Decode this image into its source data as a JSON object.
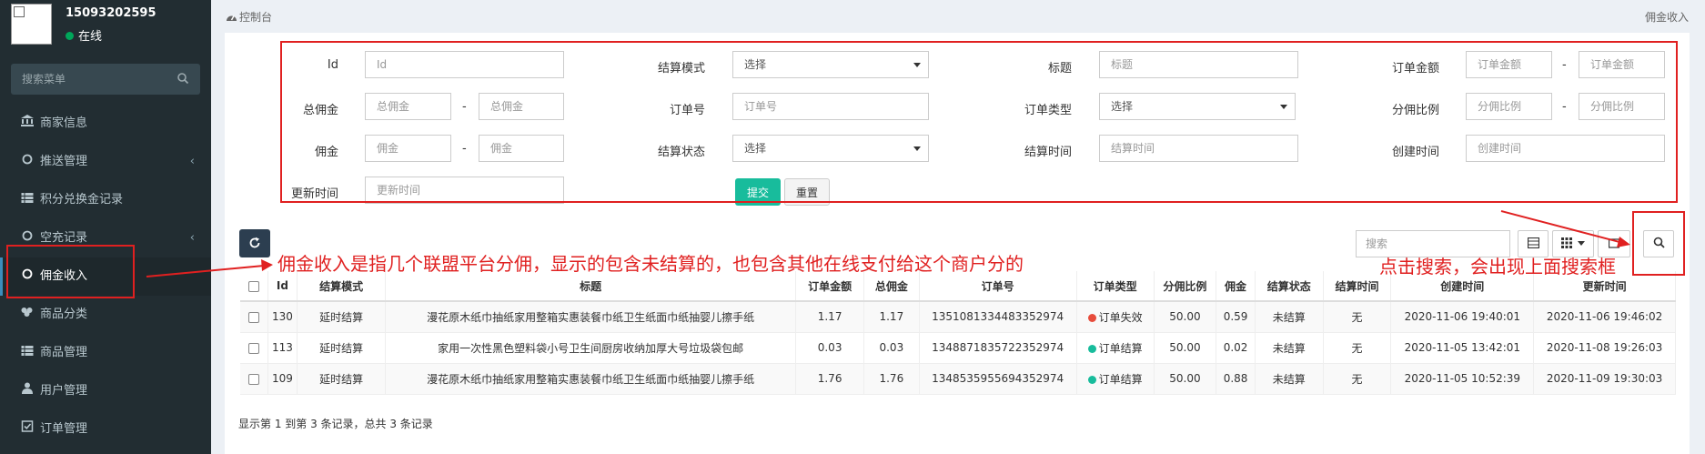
{
  "user": {
    "name": "15093202595",
    "status": "在线"
  },
  "sidebar": {
    "search_placeholder": "搜索菜单",
    "items": [
      {
        "label": "商家信息",
        "icon": "bank-icon"
      },
      {
        "label": "推送管理",
        "icon": "circle-icon"
      },
      {
        "label": "积分兑换金记录",
        "icon": "list-icon"
      },
      {
        "label": "空充记录",
        "icon": "circle-icon"
      },
      {
        "label": "佣金收入",
        "icon": "circle-icon"
      },
      {
        "label": "商品分类",
        "icon": "group-icon"
      },
      {
        "label": "商品管理",
        "icon": "list-icon"
      },
      {
        "label": "用户管理",
        "icon": "user-icon"
      },
      {
        "label": "订单管理",
        "icon": "check-square-icon"
      }
    ]
  },
  "header": {
    "breadcrumb": "控制台",
    "page_title": "佣金收入"
  },
  "form": {
    "id_label": "Id",
    "id_placeholder": "Id",
    "settle_mode_label": "结算模式",
    "settle_mode_value": "选择",
    "title_label": "标题",
    "title_placeholder": "标题",
    "order_amount_label": "订单金额",
    "order_amount_placeholder": "订单金额",
    "total_comm_label": "总佣金",
    "total_comm_placeholder": "总佣金",
    "order_no_label": "订单号",
    "order_no_placeholder": "订单号",
    "order_type_label": "订单类型",
    "order_type_value": "选择",
    "share_ratio_label": "分佣比例",
    "share_ratio_placeholder": "分佣比例",
    "comm_label": "佣金",
    "comm_placeholder": "佣金",
    "settle_status_label": "结算状态",
    "settle_status_value": "选择",
    "settle_time_label": "结算时间",
    "settle_time_placeholder": "结算时间",
    "create_time_label": "创建时间",
    "create_time_placeholder": "创建时间",
    "update_time_label": "更新时间",
    "update_time_placeholder": "更新时间",
    "dash": "-",
    "submit": "提交",
    "reset": "重置"
  },
  "toolbar": {
    "search_placeholder": "搜索"
  },
  "annotations": {
    "left": "佣金收入是指几个联盟平台分佣，显示的包含未结算的，也包含其他在线支付给这个商户分的",
    "right": "点击搜索，会出现上面搜索框"
  },
  "table": {
    "headers": [
      "Id",
      "结算模式",
      "标题",
      "订单金额",
      "总佣金",
      "订单号",
      "订单类型",
      "分佣比例",
      "佣金",
      "结算状态",
      "结算时间",
      "创建时间",
      "更新时间"
    ],
    "rows": [
      {
        "id": "130",
        "mode": "延时结算",
        "title": "漫花原木纸巾抽纸家用整箱实惠装餐巾纸卫生纸面巾纸抽婴儿擦手纸",
        "amount": "1.17",
        "total": "1.17",
        "order_no": "1351081334483352974",
        "type": "订单失效",
        "type_color": "#e74c3c",
        "ratio": "50.00",
        "comm": "0.59",
        "status": "未结算",
        "settle_time": "无",
        "created": "2020-11-06 19:40:01",
        "updated": "2020-11-06 19:46:02"
      },
      {
        "id": "113",
        "mode": "延时结算",
        "title": "家用一次性黑色塑料袋小号卫生间厨房收纳加厚大号垃圾袋包邮",
        "amount": "0.03",
        "total": "0.03",
        "order_no": "1348871835722352974",
        "type": "订单结算",
        "type_color": "#18bc9c",
        "ratio": "50.00",
        "comm": "0.02",
        "status": "未结算",
        "settle_time": "无",
        "created": "2020-11-05 13:42:01",
        "updated": "2020-11-08 19:26:03"
      },
      {
        "id": "109",
        "mode": "延时结算",
        "title": "漫花原木纸巾抽纸家用整箱实惠装餐巾纸卫生纸面巾纸抽婴儿擦手纸",
        "amount": "1.76",
        "total": "1.76",
        "order_no": "1348535955694352974",
        "type": "订单结算",
        "type_color": "#18bc9c",
        "ratio": "50.00",
        "comm": "0.88",
        "status": "未结算",
        "settle_time": "无",
        "created": "2020-11-05 10:52:39",
        "updated": "2020-11-09 19:30:03"
      }
    ],
    "summary": "显示第 1 到第 3 条记录，总共 3 条记录"
  }
}
